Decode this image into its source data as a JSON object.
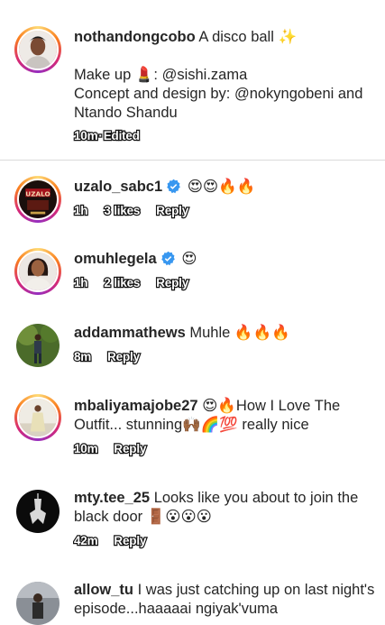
{
  "caption": {
    "username": "nothandongcobo",
    "line1": "A disco ball ✨",
    "line2": "Make up 💄: @sishi.zama",
    "line3": "Concept and design by: @nokyngobeni and Ntando Shandu",
    "time": "10m",
    "edited": "Edited"
  },
  "comments": [
    {
      "username": "uzalo_sabc1",
      "verified": true,
      "text": "😍😍🔥🔥",
      "time": "1h",
      "likes": "3 likes",
      "reply": "Reply"
    },
    {
      "username": "omuhlegela",
      "verified": true,
      "text": "😍",
      "time": "1h",
      "likes": "2 likes",
      "reply": "Reply"
    },
    {
      "username": "addammathews",
      "verified": false,
      "text": "Muhle 🔥🔥🔥",
      "time": "8m",
      "reply": "Reply"
    },
    {
      "username": "mbaliyamajobe27",
      "verified": false,
      "text": "😍🔥How I Love The Outfit... stunning🙌🏾🌈💯 really nice",
      "time": "10m",
      "reply": "Reply"
    },
    {
      "username": "mty.tee_25",
      "verified": false,
      "text": "Looks like you about to join the black door 🚪😮😮😮",
      "time": "42m",
      "reply": "Reply"
    },
    {
      "username": "allow_tu",
      "verified": false,
      "text": "I was just catching up on last night's episode...haaaaai ngiyak'vuma",
      "time": "",
      "reply": ""
    }
  ],
  "colors": {
    "text": "#262626",
    "verified": "#3897f0",
    "divider": "#dbdbdb"
  }
}
